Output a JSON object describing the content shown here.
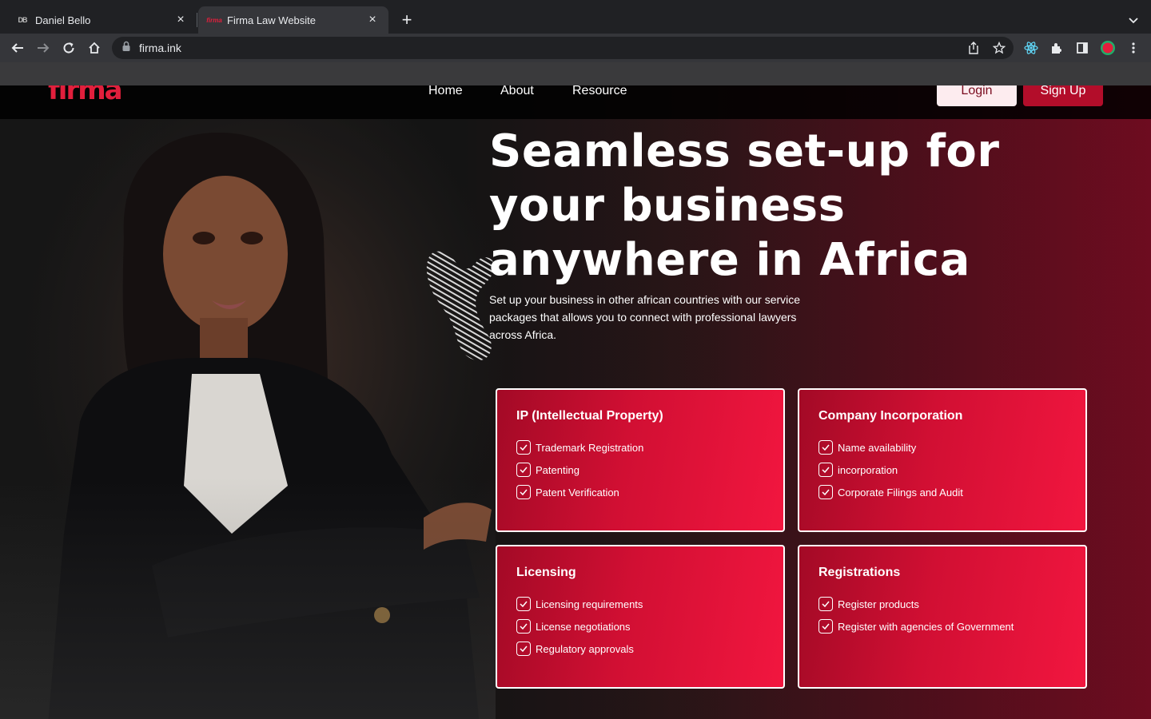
{
  "browser": {
    "tabs": [
      {
        "favicon": "DB",
        "title": "Daniel Bello",
        "active": false
      },
      {
        "favicon": "firma",
        "title": "Firma Law Website",
        "active": true
      }
    ],
    "url": "firma.ink",
    "icons": [
      "back-icon",
      "forward-icon",
      "reload-icon",
      "home-icon",
      "lock-icon",
      "share-icon",
      "star-icon",
      "react-devtools-icon",
      "extensions-icon",
      "sidepanel-icon",
      "profile-icon",
      "menu-icon"
    ]
  },
  "header": {
    "logo": {
      "part1": "fir",
      "part2": "ma"
    },
    "nav": [
      "Home",
      "About",
      "Resource"
    ],
    "login": "Login",
    "signup": "Sign Up"
  },
  "hero": {
    "title": "Seamless set-up for your business anywhere in Africa",
    "subtitle": "Set up your business in other african countries with our service packages that allows you to connect with professional lawyers across Africa."
  },
  "cards": [
    {
      "title": "IP (Intellectual Property)",
      "items": [
        "Trademark Registration",
        "Patenting",
        "Patent Verification"
      ]
    },
    {
      "title": "Company Incorporation",
      "items": [
        "Name availability",
        "incorporation",
        "Corporate Filings and Audit"
      ]
    },
    {
      "title": "Licensing",
      "items": [
        "Licensing requirements",
        "License negotiations",
        "Regulatory approvals"
      ]
    },
    {
      "title": "Registrations",
      "items": [
        "Register products",
        "Register with agencies of Government"
      ]
    }
  ],
  "colors": {
    "brand": "#e21f3c",
    "brand_dark": "#b30d2a",
    "login_bg": "#fdecef"
  }
}
